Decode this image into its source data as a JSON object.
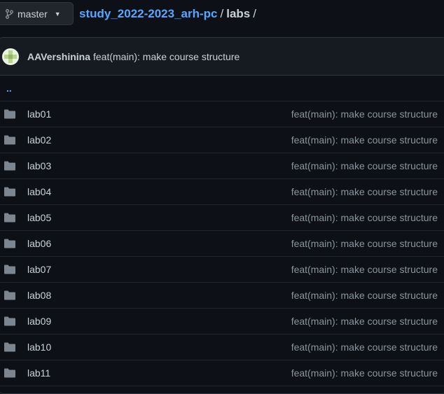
{
  "branch": {
    "label": "master"
  },
  "breadcrumb": {
    "repo": "study_2022-2023_arh-pc",
    "separator": "/",
    "dir": "labs",
    "trailing": "/"
  },
  "commit": {
    "author": "AAVershinina",
    "message": "feat(main): make course structure"
  },
  "parent_link": "..",
  "files": [
    {
      "name": "lab01",
      "message": "feat(main): make course structure"
    },
    {
      "name": "lab02",
      "message": "feat(main): make course structure"
    },
    {
      "name": "lab03",
      "message": "feat(main): make course structure"
    },
    {
      "name": "lab04",
      "message": "feat(main): make course structure"
    },
    {
      "name": "lab05",
      "message": "feat(main): make course structure"
    },
    {
      "name": "lab06",
      "message": "feat(main): make course structure"
    },
    {
      "name": "lab07",
      "message": "feat(main): make course structure"
    },
    {
      "name": "lab08",
      "message": "feat(main): make course structure"
    },
    {
      "name": "lab09",
      "message": "feat(main): make course structure"
    },
    {
      "name": "lab10",
      "message": "feat(main): make course structure"
    },
    {
      "name": "lab11",
      "message": "feat(main): make course structure"
    }
  ],
  "colors": {
    "background": "#0d1117",
    "link": "#58a6ff",
    "muted": "#8b949e",
    "border": "#30363d"
  },
  "icons": {
    "branch": "git-branch-icon",
    "folder": "folder-icon",
    "caret": "chevron-down-icon"
  }
}
